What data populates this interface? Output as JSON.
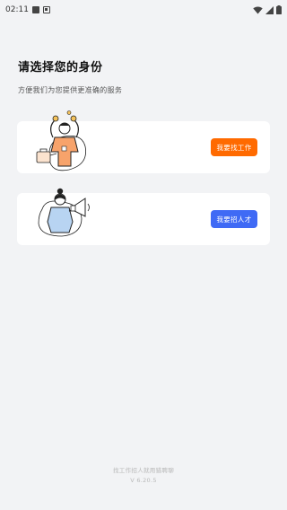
{
  "status_bar": {
    "time": "02:11"
  },
  "header": {
    "title": "请选择您的身份",
    "subtitle": "方便我们为您提供更准确的服务"
  },
  "cards": {
    "job_seeker": {
      "button_label": "我要找工作",
      "button_color": "#ff6a00"
    },
    "recruiter": {
      "button_label": "我要招人才",
      "button_color": "#3f6af5"
    }
  },
  "footer": {
    "text": "找工作招人就用猎聘聊",
    "version": "V 6.20.5"
  },
  "colors": {
    "background": "#f2f3f5",
    "card": "#ffffff"
  }
}
